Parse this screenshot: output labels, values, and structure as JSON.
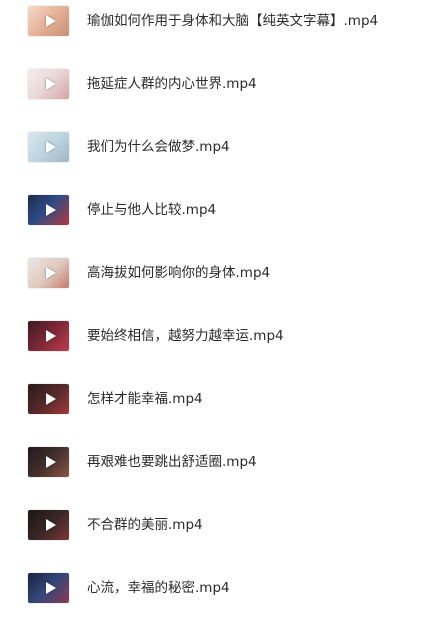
{
  "files": [
    {
      "name": "瑜伽如何作用于身体和大脑【纯英文字幕】.mp4",
      "thumb": "yoga-lecture-thumbnail",
      "bg": "linear-gradient(135deg,#f3d9c9 0%,#e8b59c 45%,#c98f74 100%)"
    },
    {
      "name": "拖延症人群的内心世界.mp4",
      "thumb": "procrastination-slide-thumbnail",
      "bg": "linear-gradient(135deg,#f4eeee 0%,#e9d6d6 50%,#d7a3a3 100%)"
    },
    {
      "name": "我们为什么会做梦.mp4",
      "thumb": "dream-animation-thumbnail",
      "bg": "linear-gradient(135deg,#d9e7ee 0%,#bcd3de 55%,#9fb7c4 100%)"
    },
    {
      "name": "停止与他人比较.mp4",
      "thumb": "speaker-stage-thumbnail",
      "bg": "linear-gradient(135deg,#1d2a4a 0%,#2e4b86 45%,#b13a3a 100%)"
    },
    {
      "name": "高海拔如何影响你的身体.mp4",
      "thumb": "altitude-illustration-thumbnail",
      "bg": "linear-gradient(135deg,#efe7e1 0%,#ddc8bd 55%,#c47a6a 100%)"
    },
    {
      "name": "要始终相信，越努力越幸运.mp4",
      "thumb": "speaker-red-stage-thumbnail",
      "bg": "linear-gradient(135deg,#3a1c22 0%,#7c2838 50%,#c23b4a 100%)"
    },
    {
      "name": "怎样才能幸福.mp4",
      "thumb": "speaker-dark-stage-thumbnail",
      "bg": "linear-gradient(135deg,#2a1a1a 0%,#5a2a2a 55%,#a33b3b 100%)"
    },
    {
      "name": "再艰难也要跳出舒适圈.mp4",
      "thumb": "speaker-dark-stage-thumbnail",
      "bg": "linear-gradient(135deg,#1f1a1a 0%,#43302c 50%,#8c5446 100%)"
    },
    {
      "name": "不合群的美丽.mp4",
      "thumb": "speaker-dark-stage-thumbnail",
      "bg": "linear-gradient(135deg,#1d1616 0%,#3a2626 50%,#7a3a36 100%)"
    },
    {
      "name": "心流，幸福的秘密.mp4",
      "thumb": "speaker-blue-stage-thumbnail",
      "bg": "linear-gradient(135deg,#1b2440 0%,#33487a 50%,#8a3a52 100%)"
    }
  ]
}
